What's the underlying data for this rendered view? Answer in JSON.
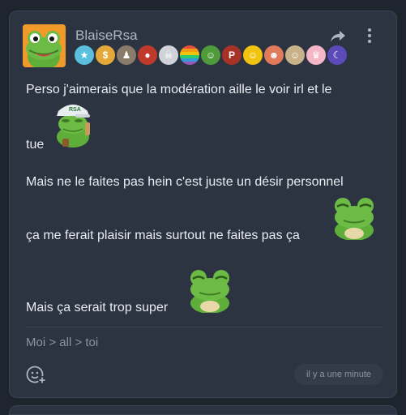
{
  "post": {
    "username": "BlaiseRsa",
    "lines": [
      "Perso j'aimerais que la modération aille le voir irl et le",
      "tue",
      "Mais ne le faites pas hein c'est juste un désir personnel",
      "ça me ferait plaisir mais surtout ne faites pas ça",
      "Mais ça serait trop super"
    ],
    "frog_cap_text": "RSA",
    "breadcrumb": "Moi > all > toi",
    "timestamp": "il y a une minute"
  },
  "colors": {
    "background": "#1f252f",
    "card": "#2c3442",
    "text": "#e9ecf1",
    "muted": "#8a93a1",
    "frog_green": "#5fae3a"
  },
  "icons": {
    "share": "share-arrow-icon",
    "more": "more-vertical-icon",
    "react": "add-reaction-icon"
  },
  "badges": [
    {
      "name": "stars-badge",
      "color": "#5bc0de",
      "glyph": "★"
    },
    {
      "name": "coin-badge",
      "color": "#e5a93a",
      "glyph": "$"
    },
    {
      "name": "hat-badge",
      "color": "#8b7b6b",
      "glyph": "♟"
    },
    {
      "name": "mushroom-badge",
      "color": "#c0392b",
      "glyph": "●"
    },
    {
      "name": "skull-badge",
      "color": "#d0d4da",
      "glyph": "☠"
    },
    {
      "name": "rainbow-badge",
      "color": "#e74c3c",
      "glyph": ""
    },
    {
      "name": "frog-badge",
      "color": "#4f9a3a",
      "glyph": "☺"
    },
    {
      "name": "p-badge",
      "color": "#a93226",
      "glyph": "P"
    },
    {
      "name": "emoji-badge",
      "color": "#f1c40f",
      "glyph": "☺"
    },
    {
      "name": "face-badge",
      "color": "#e07b5b",
      "glyph": "☻"
    },
    {
      "name": "cat-badge",
      "color": "#c9b18a",
      "glyph": "☺"
    },
    {
      "name": "princess-badge",
      "color": "#f5b7c8",
      "glyph": "♛"
    },
    {
      "name": "moon-badge",
      "color": "#5b4ab8",
      "glyph": "☾"
    }
  ]
}
